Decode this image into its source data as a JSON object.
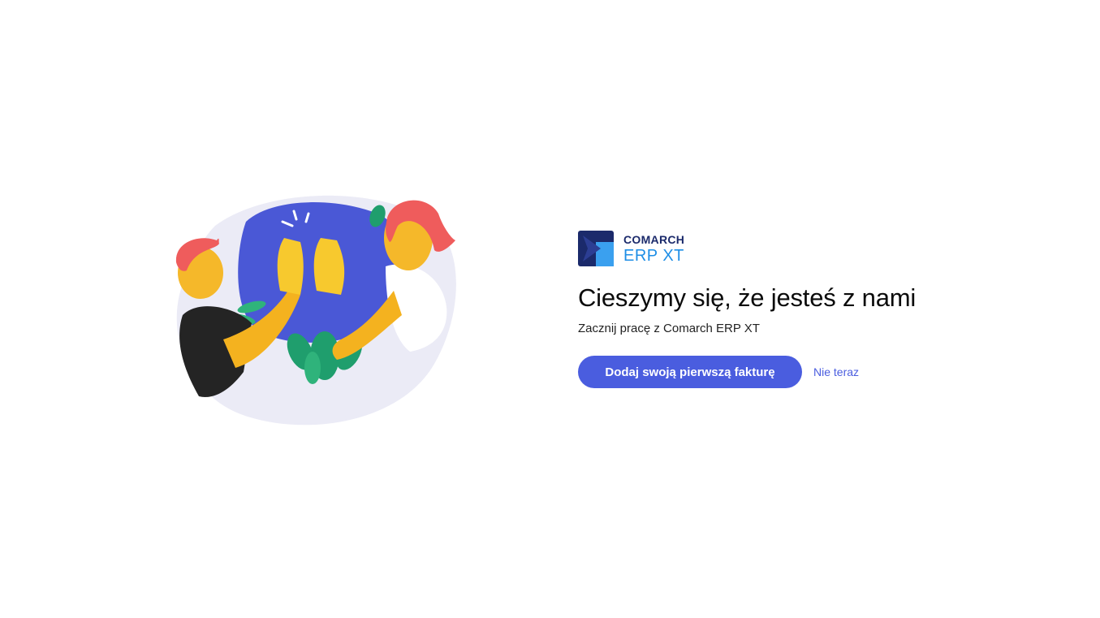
{
  "brand": {
    "company": "COMARCH",
    "product": "ERP XT",
    "icon": "comarch-logo-icon"
  },
  "welcome": {
    "title": "Cieszymy się, że jesteś z nami",
    "subtitle": "Zacznij pracę z Comarch ERP XT"
  },
  "actions": {
    "primary_label": "Dodaj swoją pierwszą fakturę",
    "secondary_label": "Nie teraz"
  },
  "illustration": {
    "icon": "high-five-illustration"
  },
  "colors": {
    "accent": "#4a5ddf",
    "brand_dark": "#1b2a6b",
    "brand_light": "#1e8ee6"
  }
}
